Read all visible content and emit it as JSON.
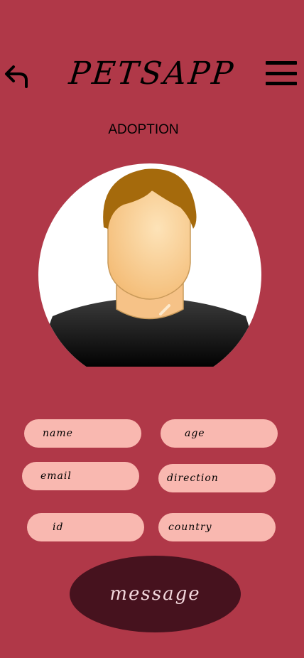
{
  "header": {
    "back_icon": "undo-arrow-icon",
    "title": "PETSAPP",
    "menu_icon": "hamburger-menu-icon"
  },
  "page": {
    "section_title": "ADOPTION"
  },
  "profile": {
    "avatar": "person-avatar"
  },
  "form": {
    "name_placeholder": "name",
    "age_placeholder": "age",
    "email_placeholder": "email",
    "direction_placeholder": "direction",
    "id_placeholder": "id",
    "country_placeholder": "country"
  },
  "actions": {
    "message_label": "message"
  },
  "colors": {
    "background": "#b03848",
    "field": "#f9b8b0",
    "button": "#46121e"
  }
}
